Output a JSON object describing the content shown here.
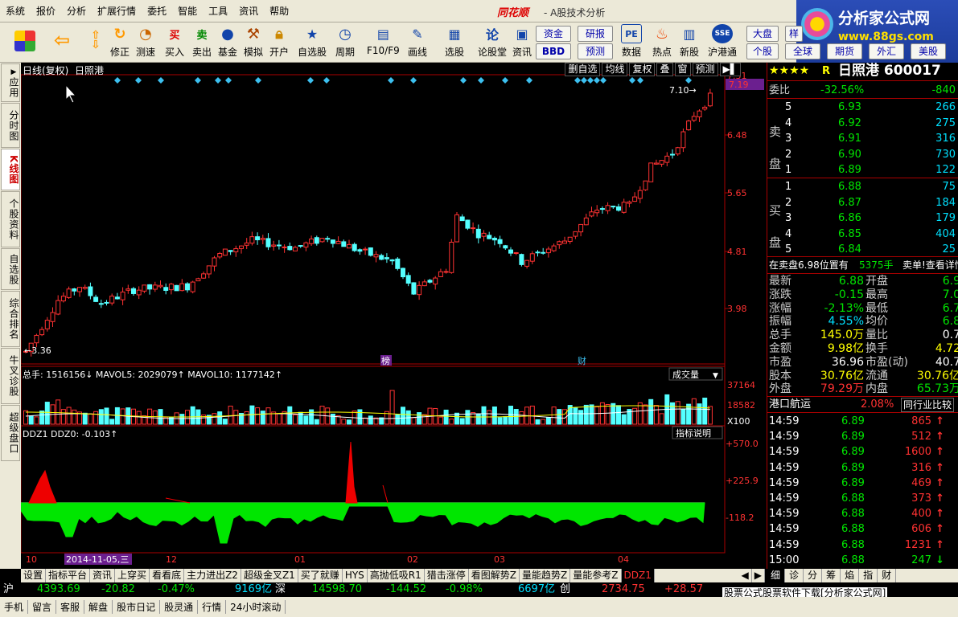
{
  "menu": [
    "系统",
    "报价",
    "分析",
    "扩展行情",
    "委托",
    "智能",
    "工具",
    "资讯",
    "帮助"
  ],
  "brand": {
    "name": "同花顺",
    "sub": "- A股技术分析"
  },
  "ad": {
    "title": "分析家公式网",
    "url": "www.88gs.com"
  },
  "toolbar": {
    "buttons": [
      "修正",
      "测速",
      "买入",
      "卖出",
      "基金",
      "模拟",
      "开户",
      "自选股",
      "周期",
      "F10/F9",
      "画线",
      "选股",
      "论股堂",
      "资讯",
      "数据",
      "热点",
      "新股",
      "沪港通"
    ],
    "boxes": {
      "zijin": "资金",
      "bbd": "BBD",
      "yanbao": "研报",
      "yuce": "预测",
      "dapan": "大盘",
      "gegu": "个股",
      "quanqiu": "全球",
      "qihuo": "期货",
      "waihui": "外汇",
      "meigu": "美股"
    },
    "buy_icon": "买",
    "sell_icon": "卖"
  },
  "left_tabs": [
    "应用",
    "分时图",
    "K线图",
    "个股资料",
    "自选股",
    "综合排名",
    "牛叉诊股",
    "超级盘口"
  ],
  "chart": {
    "title": "日线(复权)",
    "stock": "日照港",
    "buttons": [
      "删自选",
      "均线",
      "复权",
      "叠",
      "窗",
      "预测"
    ],
    "price_ticks": [
      "7.31",
      "6.48",
      "5.65",
      "4.81",
      "3.98"
    ],
    "current_price_tag": "7.19",
    "high_label": "7.10→",
    "low_label": "←3.36",
    "markers": {
      "bang": "榜",
      "cai": "财"
    },
    "volume_title": "总手: 1516156↓  MAVOL5: 2029079↑  MAVOL10: 1177142↑",
    "volume_dropdown": "成交量",
    "volume_ticks": [
      "37164",
      "18582",
      "X100"
    ],
    "ind_title": "DDZ1  DDZ0: -0.103↑",
    "ind_button": "指标说明",
    "ind_ticks": [
      "+570.0",
      "+225.9",
      "-118.2"
    ],
    "x_labels": [
      "10",
      "2014-11-05,三",
      "12",
      "01",
      "02",
      "03",
      "04"
    ],
    "up_color": "#ff3232",
    "down_color": "#54ffff"
  },
  "quote": {
    "stars": "★★★★",
    "r_tag": "R",
    "name": "日照港 600017",
    "weibi_label": "委比",
    "weibi": "-32.56%",
    "weicha": "-840",
    "sell_label": "卖盘",
    "buy_label": "买盘",
    "sell": [
      [
        "5",
        "6.93",
        "266"
      ],
      [
        "4",
        "6.92",
        "275"
      ],
      [
        "3",
        "6.91",
        "316"
      ],
      [
        "2",
        "6.90",
        "730"
      ],
      [
        "1",
        "6.89",
        "122"
      ]
    ],
    "buy": [
      [
        "1",
        "6.88",
        "75"
      ],
      [
        "2",
        "6.87",
        "184"
      ],
      [
        "3",
        "6.86",
        "179"
      ],
      [
        "4",
        "6.85",
        "404"
      ],
      [
        "5",
        "6.84",
        "25"
      ]
    ],
    "note": "在卖盘6.98位置有",
    "note_vol": "5375手",
    "note_tail": "卖单!查看详情",
    "stats": [
      [
        "最新",
        "6.88",
        "开盘",
        "6.9"
      ],
      [
        "涨跌",
        "-0.15",
        "最高",
        "7.0"
      ],
      [
        "涨幅",
        "-2.13%",
        "最低",
        "6.7"
      ],
      [
        "振幅",
        "4.55%",
        "均价",
        "6.8"
      ],
      [
        "总手",
        "145.0万",
        "量比",
        "0.7"
      ],
      [
        "金额",
        "9.98亿",
        "换手",
        "4.72"
      ],
      [
        "市盈",
        "36.96",
        "市盈(动)",
        "40.7"
      ],
      [
        "股本",
        "30.76亿",
        "流通",
        "30.76亿"
      ],
      [
        "外盘",
        "79.29万",
        "内盘",
        "65.73万"
      ]
    ],
    "industry": "港口航运",
    "industry_pct": "2.08%",
    "industry_btn": "同行业比较",
    "ticks": [
      [
        "14:59",
        "6.89",
        "865",
        "up"
      ],
      [
        "14:59",
        "6.89",
        "512",
        "up"
      ],
      [
        "14:59",
        "6.89",
        "1600",
        "up"
      ],
      [
        "14:59",
        "6.89",
        "316",
        "up"
      ],
      [
        "14:59",
        "6.89",
        "469",
        "up"
      ],
      [
        "14:59",
        "6.88",
        "373",
        "up"
      ],
      [
        "14:59",
        "6.88",
        "400",
        "up"
      ],
      [
        "14:59",
        "6.88",
        "606",
        "up"
      ],
      [
        "14:59",
        "6.88",
        "1231",
        "up"
      ],
      [
        "15:00",
        "6.88",
        "247",
        "down"
      ]
    ]
  },
  "bottom_tabs": [
    "设置",
    "指标平台",
    "资讯",
    "上穿买",
    "看看底",
    "主力进出Z2",
    "超级金叉Z1",
    "买了就赚",
    "HYS",
    "高抛低吸R1",
    "猎击涨停",
    "看图解势Z",
    "量能趋势Z",
    "量能参考Z",
    "DDZ1"
  ],
  "right_bottom_tabs": [
    "细",
    "诊",
    "分",
    "筹",
    "焰",
    "指",
    "财"
  ],
  "index": {
    "sh_label": "沪",
    "sh": "4393.69",
    "sh_chg": "-20.82",
    "sh_pct": "-0.47%",
    "sh_amt": "9169亿",
    "sz_label": "深",
    "sz": "14598.70",
    "sz_chg": "-144.52",
    "sz_pct": "-0.98%",
    "sz_amt": "6697亿",
    "cy_label": "创",
    "cy": "2734.75",
    "cy_chg": "+28.57"
  },
  "status": [
    "手机",
    "留言",
    "客服",
    "解盘",
    "股市日记",
    "股灵通",
    "行情",
    "24小时滚动"
  ],
  "ad_line": "股票公式股票软件下载[分析家公式网]"
}
